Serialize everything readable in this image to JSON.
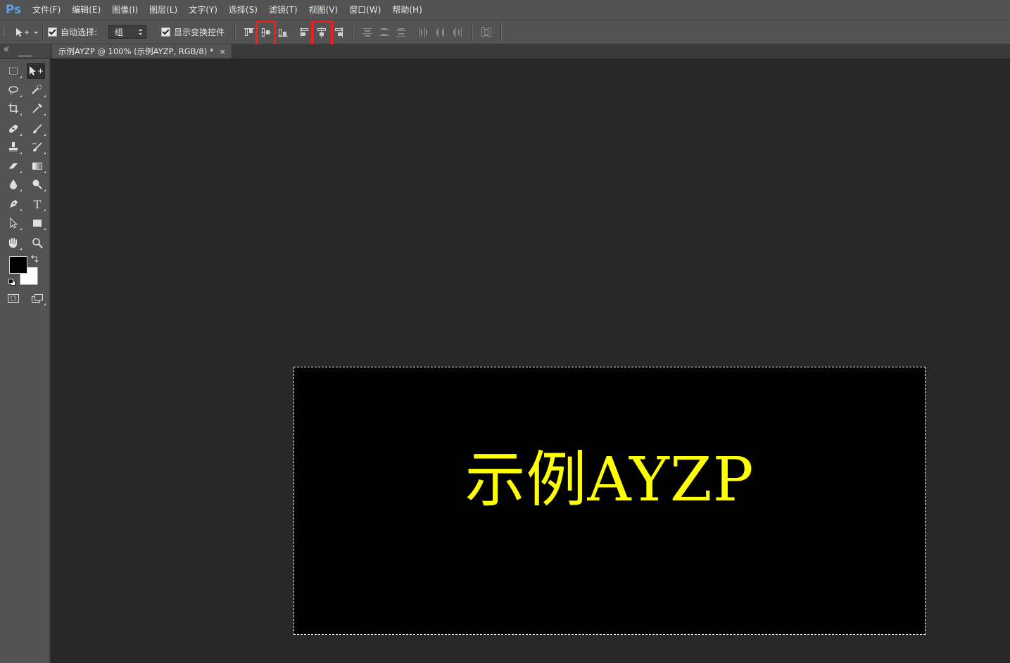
{
  "app": {
    "logo": "Ps"
  },
  "menu": [
    "文件(F)",
    "编辑(E)",
    "图像(I)",
    "图层(L)",
    "文字(Y)",
    "选择(S)",
    "滤镜(T)",
    "视图(V)",
    "窗口(W)",
    "帮助(H)"
  ],
  "options_bar": {
    "auto_select_label": "自动选择:",
    "auto_select_checked": true,
    "auto_select_value": "组",
    "show_transform_label": "显示变换控件",
    "show_transform_checked": true
  },
  "document": {
    "tab_title": "示例AYZP @ 100% (示例AYZP, RGB/8) *",
    "tab_close": "×",
    "canvas_text": "示例AYZP",
    "canvas_background": "#000000",
    "text_color": "#ffff00"
  },
  "colors": {
    "foreground": "#000000",
    "background": "#ffffff",
    "highlight": "#ff1a1a"
  },
  "tools": [
    "rect-marquee-icon",
    "move-tool-icon",
    "lasso-icon",
    "quick-selection-icon",
    "crop-icon",
    "eyedropper-icon",
    "spot-healing-icon",
    "brush-icon",
    "clone-stamp-icon",
    "history-brush-icon",
    "eraser-icon",
    "gradient-icon",
    "blur-icon",
    "dodge-icon",
    "pen-icon",
    "type-icon",
    "path-selection-icon",
    "rectangle-shape-icon",
    "hand-icon",
    "zoom-icon",
    "quick-mask-icon",
    "screen-mode-icon"
  ],
  "type_tool_glyph": "T"
}
